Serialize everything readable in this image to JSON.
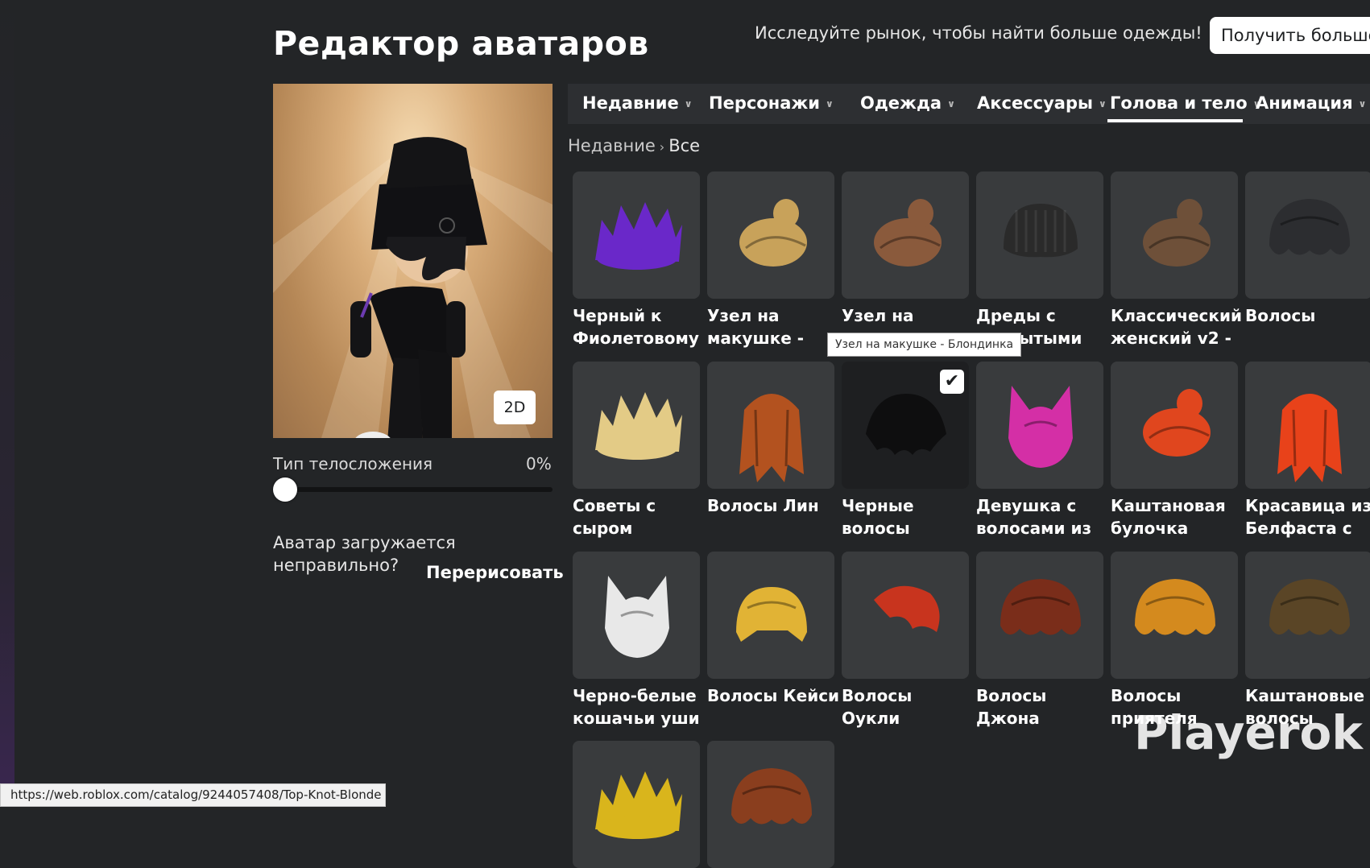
{
  "page": {
    "title": "Редактор аватаров"
  },
  "promo": {
    "text": "Исследуйте рынок, чтобы найти больше одежды!",
    "button_label": "Получить больше"
  },
  "preview": {
    "toggle_2d_label": "2D"
  },
  "body_type": {
    "label": "Тип телосложения",
    "value": "0%",
    "level_percent": 0
  },
  "redraw": {
    "question": "Аватар загружается неправильно?",
    "button_label": "Перерисовать"
  },
  "tabs": [
    {
      "label": "Недавние",
      "active": false
    },
    {
      "label": "Персонажи",
      "active": false
    },
    {
      "label": "Одежда",
      "active": false
    },
    {
      "label": "Аксессуары",
      "active": false
    },
    {
      "label": "Голова и тело",
      "active": true
    },
    {
      "label": "Анимация",
      "active": false
    }
  ],
  "breadcrumb": {
    "parent": "Недавние",
    "current": "Все"
  },
  "items": [
    {
      "name": "Черный к Фиолетовому",
      "icon": "hair-black-purple-icon",
      "color": "#6a28c9",
      "selected": false
    },
    {
      "name": "Узел на макушке -",
      "icon": "hair-top-knot-blonde-icon",
      "color": "#c8a25a",
      "selected": false
    },
    {
      "name": "Узел на",
      "icon": "hair-top-knot-brown-icon",
      "color": "#8a5a3c",
      "selected": false
    },
    {
      "name": "Дреды с открытыми",
      "icon": "hair-dreads-icon",
      "color": "#2a2a2a",
      "selected": false
    },
    {
      "name": "Классический женский v2 -",
      "icon": "hair-classic-female-icon",
      "color": "#6e5039",
      "selected": false
    },
    {
      "name": "Волосы",
      "icon": "hair-black-icon",
      "color": "#2c2d30",
      "selected": false
    },
    {
      "name": "Советы с сыром",
      "icon": "hair-cheese-tips-icon",
      "color": "#e3cb86",
      "selected": false
    },
    {
      "name": "Волосы Лин",
      "icon": "hair-lin-icon",
      "color": "#b3521f",
      "selected": false
    },
    {
      "name": "Черные волосы",
      "icon": "hair-black-messy-icon",
      "color": "#0e0e0f",
      "selected": true
    },
    {
      "name": "Девушка с волосами из",
      "icon": "hair-pink-cat-icon",
      "color": "#d42fa6",
      "selected": false
    },
    {
      "name": "Каштановая булочка",
      "icon": "hair-chestnut-bun-icon",
      "color": "#e0461e",
      "selected": false
    },
    {
      "name": "Красавица из Белфаста с",
      "icon": "hair-belfast-icon",
      "color": "#e8421a",
      "selected": false
    },
    {
      "name": "Черно-белые кошачьи уши",
      "icon": "hair-cat-ears-icon",
      "color": "#e8e8e8",
      "selected": false
    },
    {
      "name": "Волосы Кейси",
      "icon": "hair-kacey-icon",
      "color": "#e1b335",
      "selected": false
    },
    {
      "name": "Волосы Оукли",
      "icon": "hair-oakley-icon",
      "color": "#c8341e",
      "selected": false
    },
    {
      "name": "Волосы Джона",
      "icon": "hair-john-icon",
      "color": "#7a2d1a",
      "selected": false
    },
    {
      "name": "Волосы приятеля",
      "icon": "hair-buddy-icon",
      "color": "#d48a1e",
      "selected": false
    },
    {
      "name": "Каштановые волосы",
      "icon": "hair-chestnut-icon",
      "color": "#5a4526",
      "selected": false
    },
    {
      "name": "",
      "icon": "hair-yellow-spiky-icon",
      "color": "#d9b51c",
      "selected": false
    },
    {
      "name": "",
      "icon": "hair-brown-icon",
      "color": "#8a3e1e",
      "selected": false
    }
  ],
  "tooltip": {
    "text": "Узел на макушке - Блондинка"
  },
  "status_bar": {
    "url": "https://web.roblox.com/catalog/9244057408/Top-Knot-Blonde"
  },
  "watermark": {
    "text": "Playerok"
  }
}
